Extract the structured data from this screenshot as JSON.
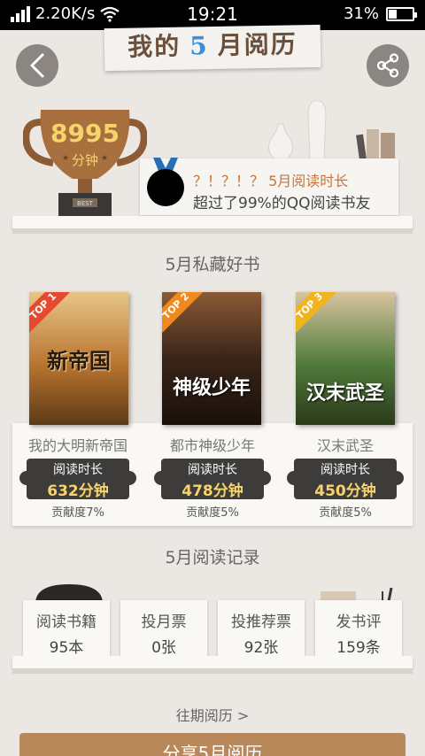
{
  "status_bar": {
    "speed": "2.20K/s",
    "time": "19:21",
    "battery": "31%",
    "battery_fraction": 0.31
  },
  "header": {
    "title_prefix": "我的",
    "title_month": "5",
    "title_suffix": "月阅历",
    "back_icon": "chevron-left-icon",
    "share_icon": "share-icon"
  },
  "summary": {
    "score": "8995",
    "score_unit": "分钟",
    "trophy_label": "BEST",
    "rank_line": "？！？！？ 5月阅读时长",
    "beat_line": "超过了99%的QQ阅读书友"
  },
  "books_section": {
    "title": "5月私藏好书",
    "books": [
      {
        "top": "TOP 1",
        "cover_text": "新帝国",
        "name": "我的大明新帝国",
        "time_label": "阅读时长",
        "time_value": "632分钟",
        "contribution": "贡献度7%",
        "cover_color": "#b8742e"
      },
      {
        "top": "TOP 2",
        "cover_text": "神级少年",
        "name": "都市神级少年",
        "time_label": "阅读时长",
        "time_value": "478分钟",
        "contribution": "贡献度5%",
        "cover_color": "#3a2418"
      },
      {
        "top": "TOP 3",
        "cover_text": "汉末武圣",
        "name": "汉末武圣",
        "time_label": "阅读时长",
        "time_value": "450分钟",
        "contribution": "贡献度5%",
        "cover_color": "#4e7a3a"
      }
    ]
  },
  "records_section": {
    "title": "5月阅读记录",
    "items": [
      {
        "label": "阅读书籍",
        "value": "95本"
      },
      {
        "label": "投月票",
        "value": "0张"
      },
      {
        "label": "投推荐票",
        "value": "92张"
      },
      {
        "label": "发书评",
        "value": "159条"
      }
    ]
  },
  "footer": {
    "history_link": "往期阅历 >",
    "share_button": "分享5月阅历"
  }
}
